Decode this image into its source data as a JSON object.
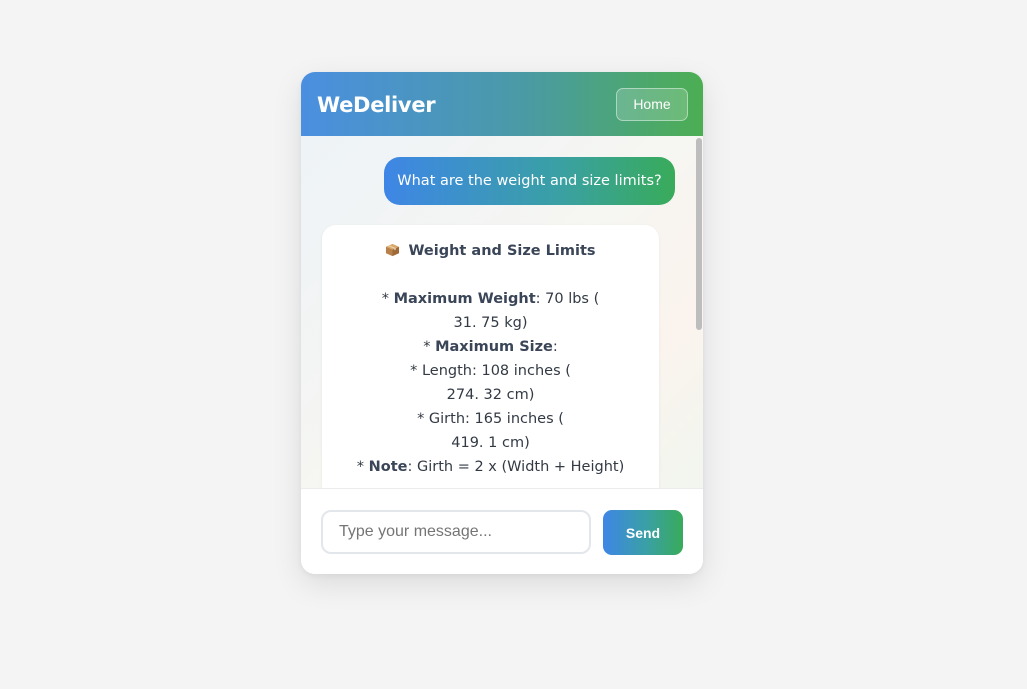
{
  "header": {
    "brand": "WeDeliver",
    "home_label": "Home"
  },
  "chat": {
    "user_message": "What are the weight and size limits?",
    "bot_reply": {
      "title_icon": "package-icon",
      "title": "Weight and Size Limits",
      "lines": [
        {
          "prefix": "* ",
          "bold": "Maximum Weight",
          "text": ": 70 lbs ("
        },
        {
          "prefix": "",
          "bold": "",
          "text": "31. 75 kg)"
        },
        {
          "prefix": "* ",
          "bold": "Maximum Size",
          "text": ":"
        },
        {
          "prefix": "",
          "bold": "",
          "text": "* Length: 108 inches ("
        },
        {
          "prefix": "",
          "bold": "",
          "text": "274. 32 cm)"
        },
        {
          "prefix": "",
          "bold": "",
          "text": "* Girth: 165 inches ("
        },
        {
          "prefix": "",
          "bold": "",
          "text": "419. 1 cm)"
        },
        {
          "prefix": "* ",
          "bold": "Note",
          "text": ": Girth = 2 x (Width + Height)"
        }
      ]
    }
  },
  "composer": {
    "placeholder": "Type your message...",
    "send_label": "Send"
  },
  "colors": {
    "page_bg": "#f4f4f5",
    "gradient_start": "#4a8fe0",
    "gradient_end": "#4cae52",
    "bot_text": "#333a44"
  }
}
